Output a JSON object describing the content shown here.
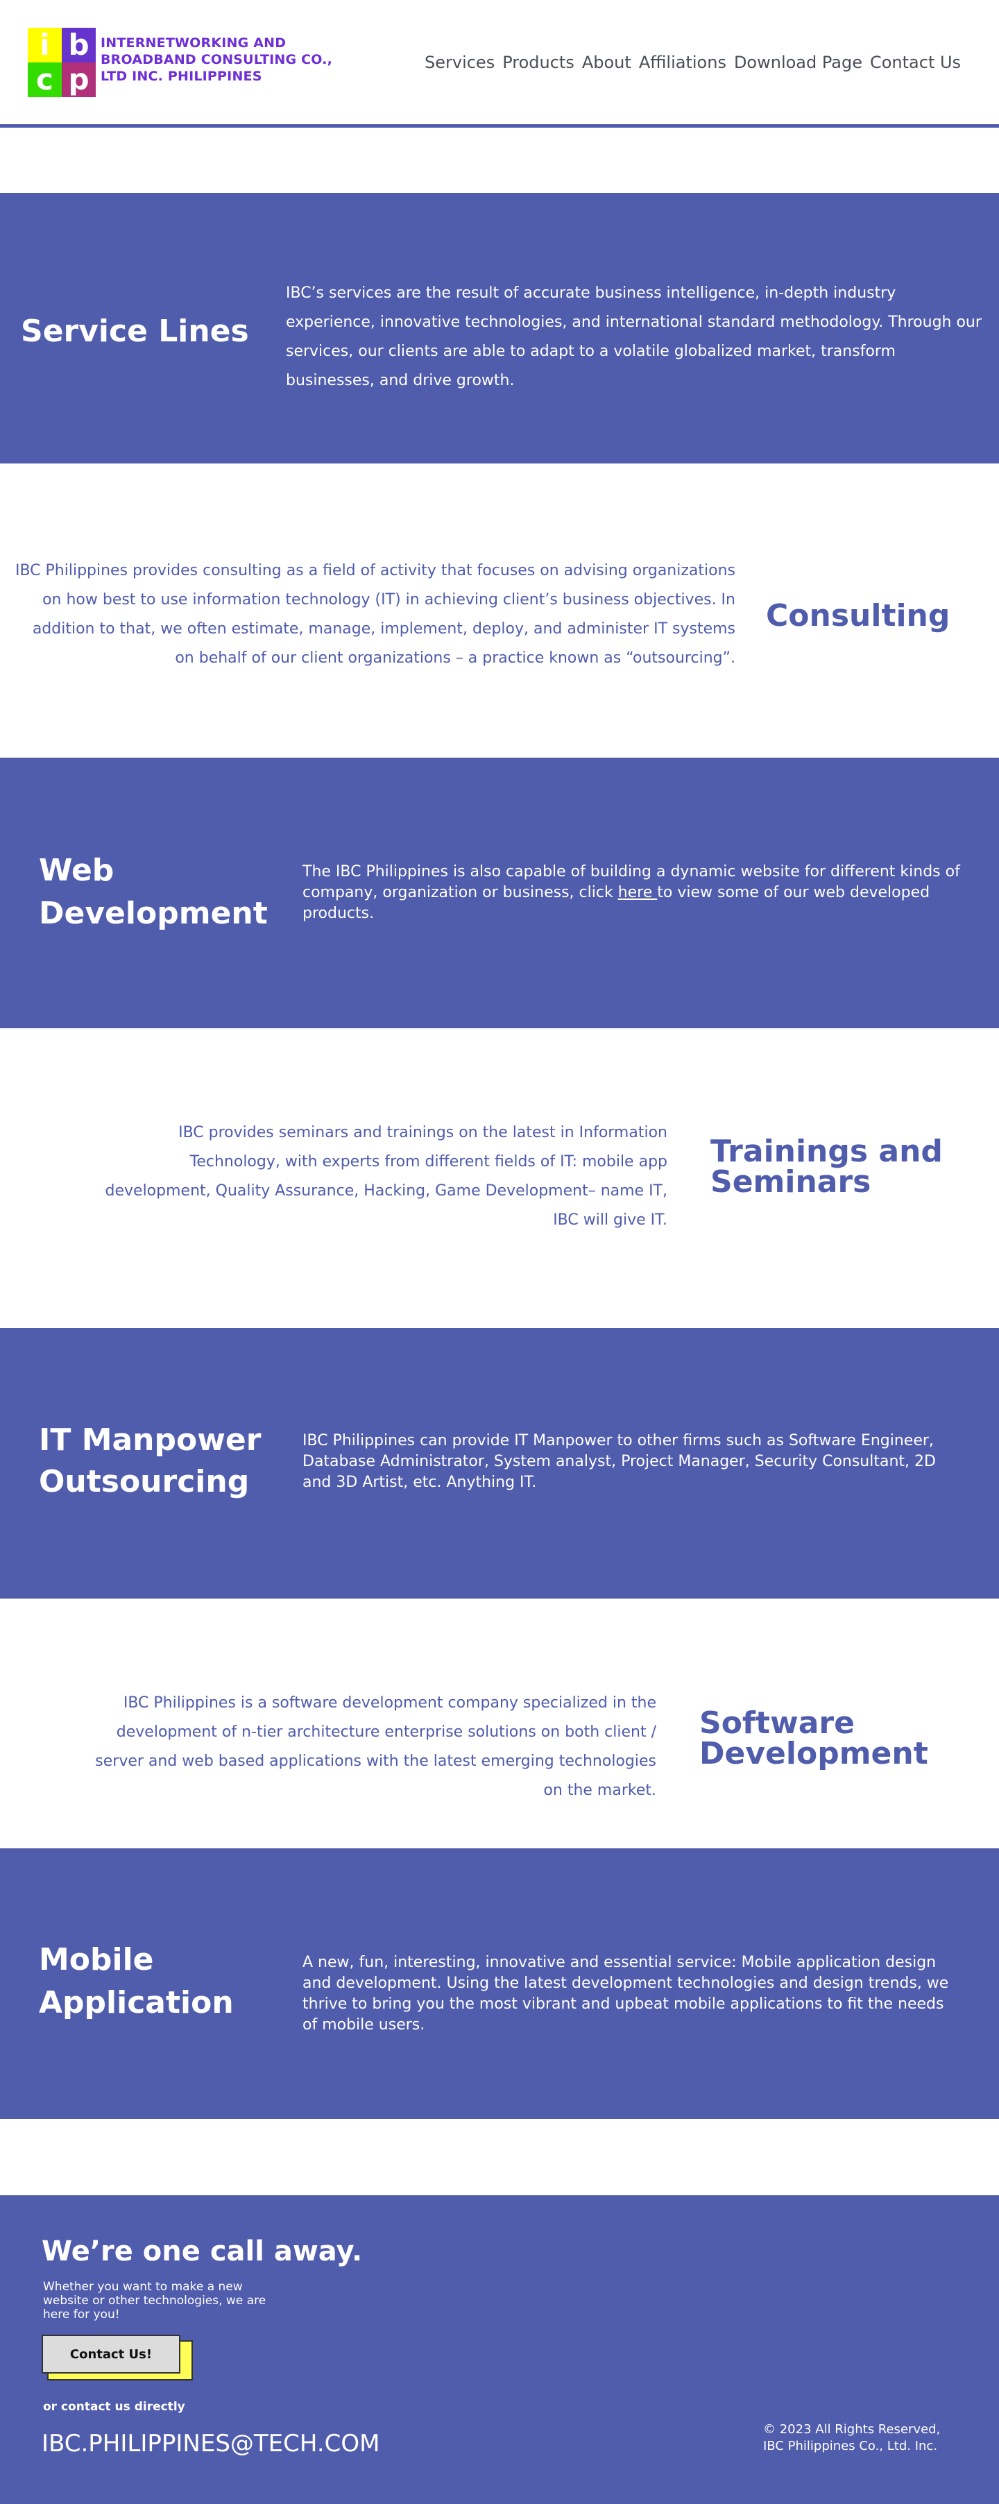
{
  "header": {
    "logo": {
      "letters": [
        "i",
        "b",
        "c",
        "p"
      ],
      "colors": [
        "#ffff00",
        "#6633cc",
        "#33dd00",
        "#b0307a"
      ]
    },
    "company_name": "INTERNETWORKING AND BROADBAND CONSULTING CO., LTD INC. PHILIPPINES",
    "nav": [
      "Services",
      "Products",
      "About",
      "Affiliations",
      "Download Page",
      "Contact Us"
    ]
  },
  "service_lines": {
    "title": "Service Lines",
    "text": "IBC’s services are the result of accurate business intelligence, in-depth industry experience, innovative technologies, and international standard methodology. Through our services, our clients are able to adapt to a volatile globalized market, transform businesses, and drive growth."
  },
  "consulting": {
    "title": "Consulting",
    "text": "IBC Philippines provides consulting as a field of activity that focuses on advising organizations on how best to use information technology (IT) in achieving client’s business objectives. In addition to that, we often estimate, manage, implement, deploy, and administer IT systems on behalf of our client organizations – a practice known as “outsourcing”."
  },
  "web_development": {
    "title": "Web Development",
    "text_before": "The IBC Philippines is also capable of building a dynamic website for different kinds of company, organization or business, click ",
    "link": "here ",
    "text_after": "to view some of our web developed products."
  },
  "trainings": {
    "title": "Trainings and Seminars",
    "text": "IBC provides seminars and trainings on the latest in Information Technology, with experts from different fields of IT: mobile app development, Quality Assurance, Hacking, Game Development– name IT, IBC will give IT."
  },
  "manpower": {
    "title": "IT Manpower Outsourcing",
    "text": "IBC Philippines can provide IT Manpower to other firms such as Software Engineer, Database Administrator, System analyst, Project Manager, Security Consultant, 2D and 3D Artist, etc. Anything IT."
  },
  "software": {
    "title": "Software Development",
    "text": "IBC Philippines is a software development company specialized in the development of n-tier architecture enterprise solutions on both client / server and web based applications with the latest emerging technologies on the market."
  },
  "mobile": {
    "title": "Mobile Application",
    "text": "A new, fun, interesting, innovative and essential service: Mobile application design and development. Using the latest development technologies and design trends, we thrive to bring you the most vibrant and upbeat mobile applications to fit the needs of mobile users."
  },
  "footer": {
    "heading": "We’re one call away.",
    "subtext": "Whether you want to make a new website or other technologies, we are here for you!",
    "button": "Contact Us!",
    "direct_label": "or contact us directly",
    "email": "IBC.PHILIPPINES@TECH.COM",
    "copyright_line1": "© 2023 All Rights Reserved,",
    "copyright_line2": "IBC Philippines Co., Ltd. Inc."
  },
  "colors": {
    "accent": "#505cac",
    "brand_text": "#6e2fd6"
  }
}
